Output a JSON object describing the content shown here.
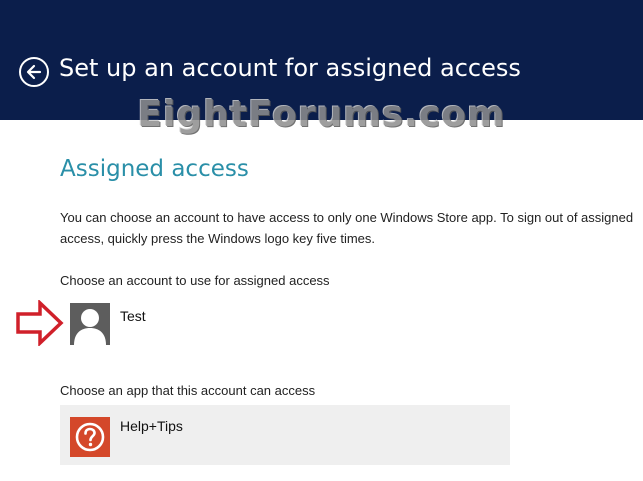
{
  "header": {
    "title": "Set up an account for assigned access",
    "back_icon": "back-arrow-icon",
    "background": "#0b1e4b"
  },
  "watermark": "EightForums.com",
  "section": {
    "title": "Assigned access",
    "description": "You can choose an account to have access to only one Windows Store app. To sign out of assigned access, quickly press the Windows logo key five times."
  },
  "account": {
    "label": "Choose an account to use for assigned access",
    "name": "Test",
    "avatar_icon": "user-avatar-icon"
  },
  "app": {
    "label": "Choose an app that this account can access",
    "name": "Help+Tips",
    "icon": "help-tips-icon",
    "icon_color": "#d4482a"
  },
  "accent_color": "#2a8fa8"
}
